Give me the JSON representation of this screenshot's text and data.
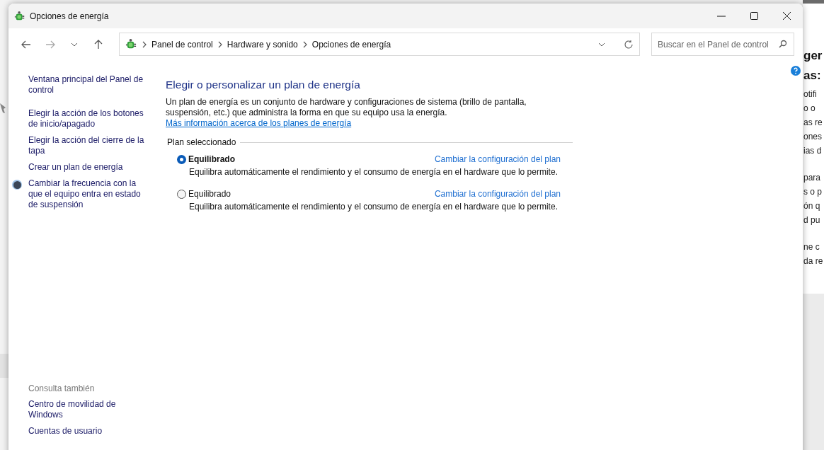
{
  "background": {
    "right_headings": [
      "ger",
      "as:"
    ],
    "right_groups": [
      [
        "otifi",
        "o o",
        "as re",
        "ones",
        "ias d"
      ],
      [
        "para",
        "s o p",
        "ón q",
        "d pu"
      ],
      [
        "ne c",
        "da re"
      ]
    ]
  },
  "window": {
    "title": "Opciones de energía"
  },
  "address_bar": {
    "breadcrumbs": [
      "Panel de control",
      "Hardware y sonido",
      "Opciones de energía"
    ]
  },
  "search": {
    "placeholder": "Buscar en el Panel de control"
  },
  "sidebar": {
    "items": [
      {
        "label": "Ventana principal del Panel de control",
        "kind": "link"
      },
      {
        "label": "Elegir la acción de los botones de inicio/apagado",
        "kind": "link"
      },
      {
        "label": "Elegir la acción del cierre de la tapa",
        "kind": "link"
      },
      {
        "label": "Crear un plan de energía",
        "kind": "link"
      },
      {
        "label": "Cambiar la frecuencia con la que el equipo entra en estado de suspensión",
        "kind": "shield"
      }
    ],
    "see_also": {
      "heading": "Consulta también",
      "items": [
        "Centro de movilidad de Windows",
        "Cuentas de usuario"
      ]
    }
  },
  "main": {
    "heading": "Elegir o personalizar un plan de energía",
    "intro": "Un plan de energía es un conjunto de hardware y configuraciones de sistema (brillo de pantalla, suspensión, etc.) que administra la forma en que su equipo usa la energía.",
    "intro_link": "Más información acerca de los planes de energía",
    "group_label": "Plan seleccionado",
    "plans": [
      {
        "name": "Equilibrado",
        "selected": true,
        "link": "Cambiar la configuración del plan",
        "description": "Equilibra automáticamente el rendimiento y el consumo de energía en el hardware que lo permite."
      },
      {
        "name": "Equilibrado",
        "selected": false,
        "link": "Cambiar la configuración del plan",
        "description": "Equilibra automáticamente el rendimiento y el consumo de energía en el hardware que lo permite."
      }
    ]
  }
}
